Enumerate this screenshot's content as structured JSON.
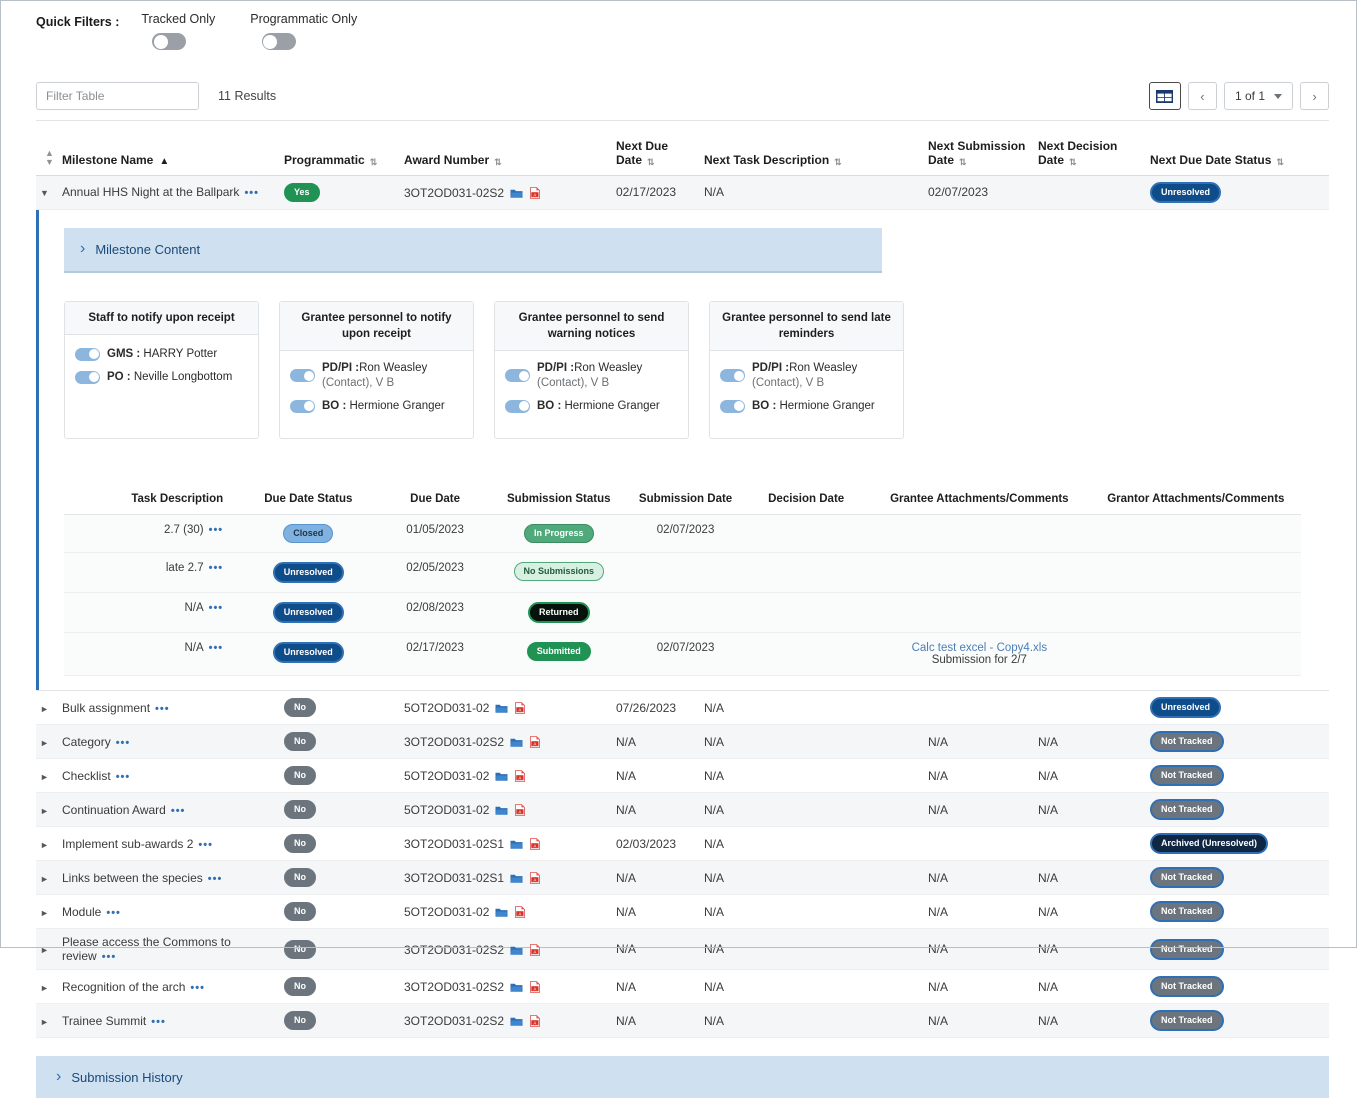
{
  "quick_filters": {
    "label": "Quick Filters :",
    "toggles": [
      {
        "name": "Tracked Only",
        "state": "off"
      },
      {
        "name": "Programmatic Only",
        "state": "off"
      }
    ]
  },
  "filter_bar": {
    "filter_placeholder": "Filter Table",
    "filter_value": "",
    "results": "11 Results",
    "grid_icon": "grid-view-icon",
    "prev_label": "‹",
    "next_label": "›",
    "page_label": "1 of 1"
  },
  "main_table": {
    "columns": [
      {
        "label": "",
        "sort": "none"
      },
      {
        "label": "Milestone Name",
        "sort": "asc"
      },
      {
        "label": "Programmatic",
        "sort": "none"
      },
      {
        "label": "Award Number",
        "sort": "none"
      },
      {
        "label": "Next Due Date",
        "sort": "none"
      },
      {
        "label": "Next Task Description",
        "sort": "none"
      },
      {
        "label": "Next Submission Date",
        "sort": "none"
      },
      {
        "label": "Next Decision Date",
        "sort": "none"
      },
      {
        "label": "Next Due Date Status",
        "sort": "none"
      }
    ],
    "rows": [
      {
        "expanded": true,
        "milestone_name": "Annual HHS Night at the Ballpark",
        "programmatic": "Yes",
        "programmatic_kind": "yes",
        "award_number": "3OT2OD031-02S2",
        "next_due_date": "02/17/2023",
        "next_task_description": "N/A",
        "next_submission_date": "02/07/2023",
        "next_decision_date": "",
        "status": "Unresolved",
        "status_kind": "unresolved"
      },
      {
        "expanded": false,
        "milestone_name": "Bulk assignment",
        "programmatic": "No",
        "programmatic_kind": "no",
        "award_number": "5OT2OD031-02",
        "next_due_date": "07/26/2023",
        "next_task_description": "N/A",
        "next_submission_date": "",
        "next_decision_date": "",
        "status": "Unresolved",
        "status_kind": "unresolved"
      },
      {
        "expanded": false,
        "milestone_name": "Category",
        "programmatic": "No",
        "programmatic_kind": "no",
        "award_number": "3OT2OD031-02S2",
        "next_due_date": "N/A",
        "next_task_description": "N/A",
        "next_submission_date": "N/A",
        "next_decision_date": "N/A",
        "status": "Not Tracked",
        "status_kind": "nottracked"
      },
      {
        "expanded": false,
        "milestone_name": "Checklist",
        "programmatic": "No",
        "programmatic_kind": "no",
        "award_number": "5OT2OD031-02",
        "next_due_date": "N/A",
        "next_task_description": "N/A",
        "next_submission_date": "N/A",
        "next_decision_date": "N/A",
        "status": "Not Tracked",
        "status_kind": "nottracked"
      },
      {
        "expanded": false,
        "milestone_name": "Continuation Award",
        "programmatic": "No",
        "programmatic_kind": "no",
        "award_number": "5OT2OD031-02",
        "next_due_date": "N/A",
        "next_task_description": "N/A",
        "next_submission_date": "N/A",
        "next_decision_date": "N/A",
        "status": "Not Tracked",
        "status_kind": "nottracked"
      },
      {
        "expanded": false,
        "milestone_name": "Implement sub-awards 2",
        "programmatic": "No",
        "programmatic_kind": "no",
        "award_number": "3OT2OD031-02S1",
        "next_due_date": "02/03/2023",
        "next_task_description": "N/A",
        "next_submission_date": "",
        "next_decision_date": "",
        "status": "Archived (Unresolved)",
        "status_kind": "archived"
      },
      {
        "expanded": false,
        "milestone_name": "Links between the species",
        "programmatic": "No",
        "programmatic_kind": "no",
        "award_number": "3OT2OD031-02S1",
        "next_due_date": "N/A",
        "next_task_description": "N/A",
        "next_submission_date": "N/A",
        "next_decision_date": "N/A",
        "status": "Not Tracked",
        "status_kind": "nottracked"
      },
      {
        "expanded": false,
        "milestone_name": "Module",
        "programmatic": "No",
        "programmatic_kind": "no",
        "award_number": "5OT2OD031-02",
        "next_due_date": "N/A",
        "next_task_description": "N/A",
        "next_submission_date": "N/A",
        "next_decision_date": "N/A",
        "status": "Not Tracked",
        "status_kind": "nottracked"
      },
      {
        "expanded": false,
        "milestone_name": "Please access the Commons to review",
        "programmatic": "No",
        "programmatic_kind": "no",
        "award_number": "3OT2OD031-02S2",
        "next_due_date": "N/A",
        "next_task_description": "N/A",
        "next_submission_date": "N/A",
        "next_decision_date": "N/A",
        "status": "Not Tracked",
        "status_kind": "nottracked"
      },
      {
        "expanded": false,
        "milestone_name": "Recognition of the arch",
        "programmatic": "No",
        "programmatic_kind": "no",
        "award_number": "3OT2OD031-02S2",
        "next_due_date": "N/A",
        "next_task_description": "N/A",
        "next_submission_date": "N/A",
        "next_decision_date": "N/A",
        "status": "Not Tracked",
        "status_kind": "nottracked"
      },
      {
        "expanded": false,
        "milestone_name": "Trainee Summit",
        "programmatic": "No",
        "programmatic_kind": "no",
        "award_number": "3OT2OD031-02S2",
        "next_due_date": "N/A",
        "next_task_description": "N/A",
        "next_submission_date": "N/A",
        "next_decision_date": "N/A",
        "status": "Not Tracked",
        "status_kind": "nottracked"
      }
    ]
  },
  "expanded": {
    "milestone_content_label": "Milestone Content",
    "cards": [
      {
        "title": "Staff to notify upon receipt",
        "entries": [
          {
            "role": "GMS :",
            "name": " HARRY Potter",
            "muted": "",
            "toggle": "on"
          },
          {
            "role": "PO :",
            "name": " Neville Longbottom",
            "muted": "",
            "toggle": "on"
          }
        ]
      },
      {
        "title": "Grantee personnel to notify upon receipt",
        "entries": [
          {
            "role": "PD/PI :",
            "name": "Ron Weasley",
            "muted": "(Contact), V B",
            "toggle": "on"
          },
          {
            "role": "BO :",
            "name": " Hermione Granger",
            "muted": "",
            "toggle": "on"
          }
        ]
      },
      {
        "title": "Grantee personnel to send warning notices",
        "entries": [
          {
            "role": "PD/PI :",
            "name": "Ron Weasley",
            "muted": "(Contact), V B",
            "toggle": "on"
          },
          {
            "role": "BO :",
            "name": " Hermione Granger",
            "muted": "",
            "toggle": "on"
          }
        ]
      },
      {
        "title": "Grantee personnel to send late reminders",
        "entries": [
          {
            "role": "PD/PI :",
            "name": "Ron Weasley",
            "muted": "(Contact), V B",
            "toggle": "on"
          },
          {
            "role": "BO :",
            "name": " Hermione Granger",
            "muted": "",
            "toggle": "on"
          }
        ]
      }
    ],
    "task_table": {
      "columns": [
        "Task Description",
        "Due Date Status",
        "Due Date",
        "Submission Status",
        "Submission Date",
        "Decision Date",
        "Grantee Attachments/Comments",
        "Grantor Attachments/Comments"
      ],
      "rows": [
        {
          "task_description": "2.7 (30)",
          "due_date_status": "Closed",
          "due_date_status_kind": "closed",
          "due_date": "01/05/2023",
          "submission_status": "In Progress",
          "submission_status_kind": "inprogress",
          "submission_date": "02/07/2023",
          "decision_date": "",
          "grantee_attachment_link": "",
          "grantee_attachment_note": "",
          "grantor_attachment": ""
        },
        {
          "task_description": "late 2.7",
          "due_date_status": "Unresolved",
          "due_date_status_kind": "unresolved",
          "due_date": "02/05/2023",
          "submission_status": "No Submissions",
          "submission_status_kind": "nosub",
          "submission_date": "",
          "decision_date": "",
          "grantee_attachment_link": "",
          "grantee_attachment_note": "",
          "grantor_attachment": ""
        },
        {
          "task_description": "N/A",
          "due_date_status": "Unresolved",
          "due_date_status_kind": "unresolved",
          "due_date": "02/08/2023",
          "submission_status": "Returned",
          "submission_status_kind": "returned",
          "submission_date": "",
          "decision_date": "",
          "grantee_attachment_link": "",
          "grantee_attachment_note": "",
          "grantor_attachment": ""
        },
        {
          "task_description": "N/A",
          "due_date_status": "Unresolved",
          "due_date_status_kind": "unresolved",
          "due_date": "02/17/2023",
          "submission_status": "Submitted",
          "submission_status_kind": "submitted",
          "submission_date": "02/07/2023",
          "decision_date": "",
          "grantee_attachment_link": "Calc test excel - Copy4.xls",
          "grantee_attachment_note": "Submission for 2/7",
          "grantor_attachment": ""
        }
      ]
    }
  },
  "footer": {
    "submission_history_label": "Submission History"
  },
  "colors": {
    "accent_blue": "#2f6fb5",
    "section_bg": "#cfe0f0",
    "green": "#1f9254",
    "grey": "#6c757d",
    "navy": "#0f4c8a"
  }
}
